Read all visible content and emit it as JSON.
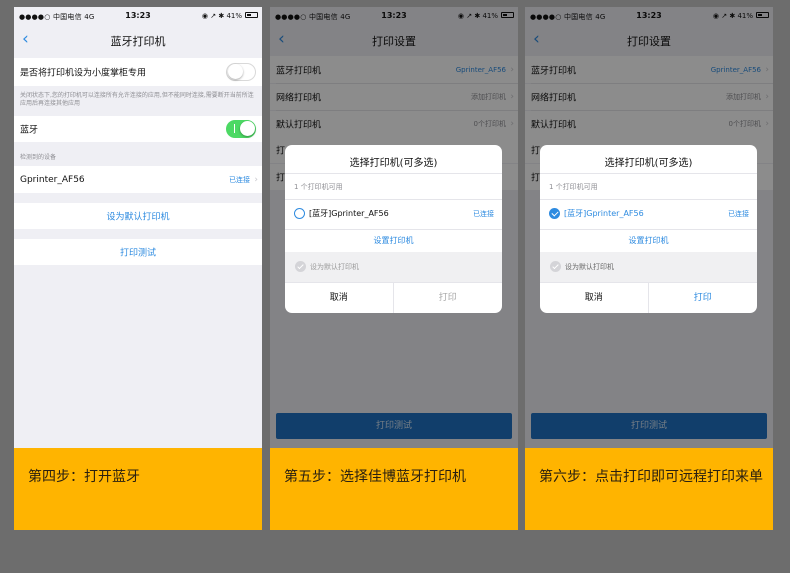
{
  "status_bar": {
    "carrier": "●●●●○ 中国电信",
    "network": "4G",
    "time": "13:23",
    "indicators": "◉ ↗ ✱",
    "battery": "41%"
  },
  "panel1": {
    "title": "蓝牙打印机",
    "cabinet_label": "是否将打印机设为小度掌柜专用",
    "cabinet_note": "关闭状态下,您的打印机可以连接所有允许连接的应用,但不能同时连接,需要断开当前所连应用后再连接其他应用",
    "bluetooth_label": "蓝牙",
    "devices_section": "检测到的设备",
    "device_name": "Gprinter_AF56",
    "device_status": "已连接",
    "set_default": "设为默认打印机",
    "print_test": "打印测试",
    "caption": "第四步：打开蓝牙",
    "cabinet_toggle_on": false,
    "bluetooth_on": true
  },
  "panel2": {
    "title": "打印设置",
    "bt_printer_label": "蓝牙打印机",
    "bt_printer_value": "Gprinter_AF56",
    "net_printer_label": "网络打印机",
    "net_printer_value": "添加打印机",
    "default_printer_label": "默认打印机",
    "default_printer_value": "0个打印机",
    "row4_label": "打",
    "row5_label": "打",
    "print_test": "打印测试",
    "dialog": {
      "title": "选择打印机(可多选)",
      "available": "1 个打印机可用",
      "printer": "[蓝牙]Gprinter_AF56",
      "printer_status": "已连接",
      "setup": "设置打印机",
      "set_default": "设为默认打印机",
      "cancel": "取消",
      "print": "打印",
      "selected": false
    },
    "caption": "第五步：选择佳博蓝牙打印机"
  },
  "panel3": {
    "title": "打印设置",
    "bt_printer_label": "蓝牙打印机",
    "bt_printer_value": "Gprinter_AF56",
    "net_printer_label": "网络打印机",
    "net_printer_value": "添加打印机",
    "default_printer_label": "默认打印机",
    "default_printer_value": "0个打印机",
    "row4_label": "打",
    "row5_label": "打",
    "print_test": "打印测试",
    "dialog": {
      "title": "选择打印机(可多选)",
      "available": "1 个打印机可用",
      "printer": "[蓝牙]Gprinter_AF56",
      "printer_status": "已连接",
      "setup": "设置打印机",
      "set_default": "设为默认打印机",
      "cancel": "取消",
      "print": "打印",
      "selected": true
    },
    "caption": "第六步：点击打印即可远程打印来单"
  },
  "colors": {
    "accent": "#2e8be0",
    "toggle_on": "#4cd964",
    "caption_bg": "#ffb400",
    "button_blue": "#1f72c4",
    "page_bg": "#6d6d6d"
  },
  "icons": {
    "back": "chevron-left-icon",
    "row_arrow": "chevron-right-icon"
  }
}
